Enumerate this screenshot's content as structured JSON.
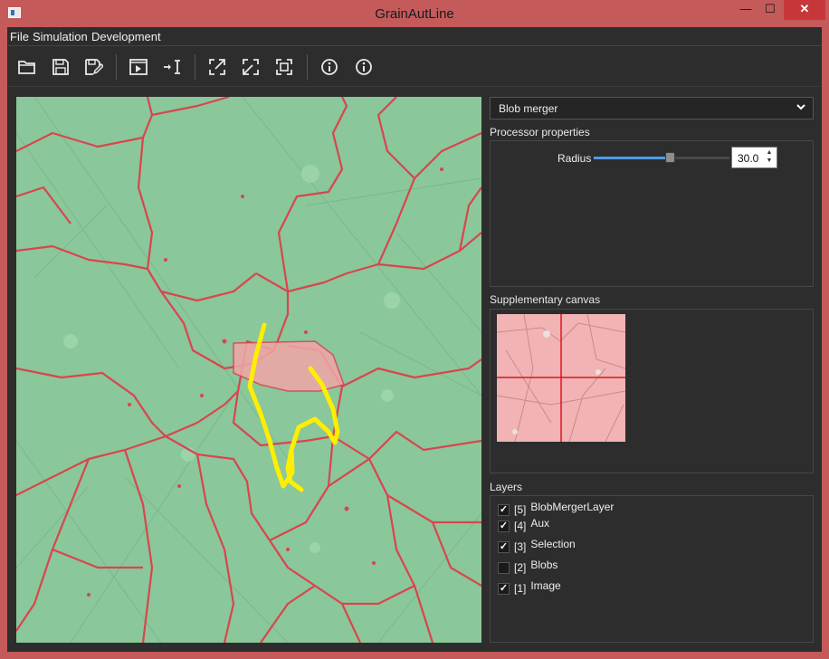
{
  "window": {
    "title": "GrainAutLine",
    "minimize_glyph": "—",
    "maximize_glyph": "☐",
    "close_glyph": "✕"
  },
  "menu": [
    {
      "label": "File",
      "accel": "F"
    },
    {
      "label": "Simulation",
      "accel": "S"
    },
    {
      "label": "Development",
      "accel": "D"
    }
  ],
  "toolbar": {
    "buttons": [
      {
        "icon": "open-folder-icon"
      },
      {
        "icon": "save-icon"
      },
      {
        "icon": "save-as-icon"
      },
      {
        "icon": "run-icon"
      },
      {
        "icon": "step-cursor-icon"
      },
      {
        "icon": "export-icon"
      },
      {
        "icon": "import-icon"
      },
      {
        "icon": "fit-view-icon"
      },
      {
        "icon": "info-icon"
      },
      {
        "icon": "info-icon"
      }
    ]
  },
  "processor": {
    "selected": "Blob merger",
    "properties_label": "Processor properties",
    "radius_label": "Radius",
    "radius_value": "30.0",
    "radius_fraction": 0.56
  },
  "supplementary": {
    "label": "Supplementary canvas"
  },
  "layers": {
    "label": "Layers",
    "items": [
      {
        "index": "[5]",
        "name": "BlobMergerLayer",
        "checked": true
      },
      {
        "index": "[4]",
        "name": "Aux",
        "checked": true
      },
      {
        "index": "[3]",
        "name": "Selection",
        "checked": true
      },
      {
        "index": "[2]",
        "name": "Blobs",
        "checked": false
      },
      {
        "index": "[1]",
        "name": "Image",
        "checked": true
      }
    ]
  },
  "colors": {
    "grain_fill": "#8ac79a",
    "boundary": "#d9454f",
    "selection_stroke": "#ffee00",
    "selected_blob": "#f2a6a6",
    "accent": "#4f9ae8"
  }
}
